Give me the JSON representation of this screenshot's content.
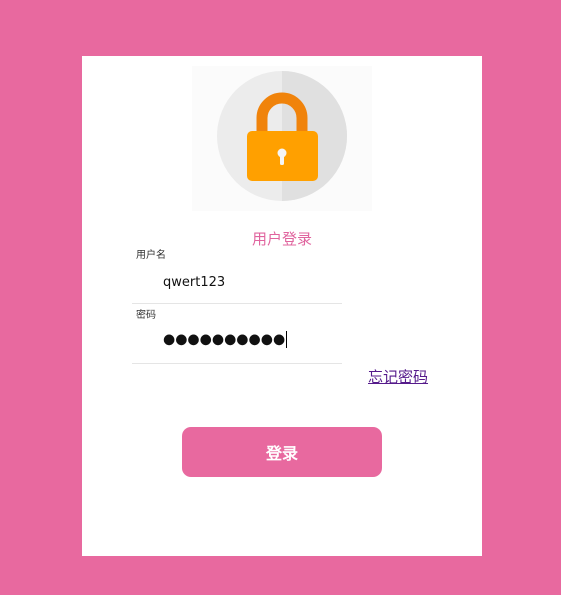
{
  "header": {
    "title": "用户登录"
  },
  "form": {
    "username_label": "用户名",
    "username_value": "qwert123",
    "password_label": "密码",
    "password_mask": "●●●●●●●●●●"
  },
  "links": {
    "forgot_password": "忘记密码"
  },
  "actions": {
    "login_label": "登录"
  },
  "icons": {
    "lock": "padlock-icon"
  },
  "colors": {
    "background": "#e8699f",
    "accent": "#e0649e",
    "lock_body": "#ffa000",
    "lock_shackle": "#f0830b"
  }
}
